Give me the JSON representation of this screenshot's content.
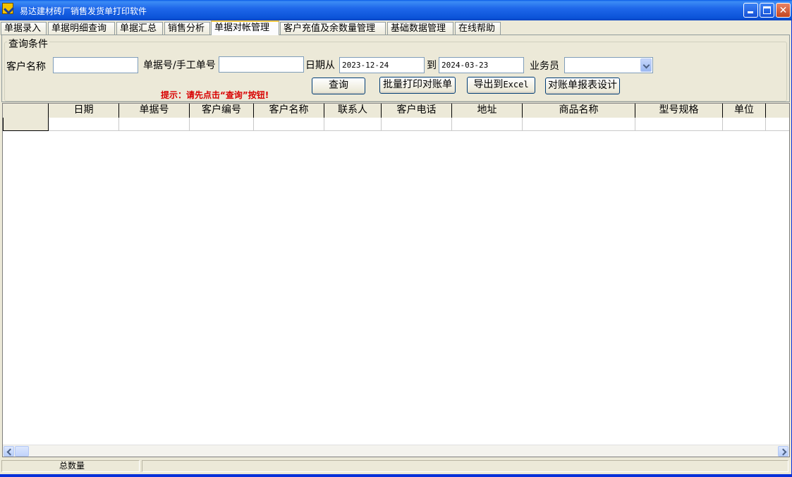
{
  "window": {
    "title": "易达建材砖厂销售发货单打印软件",
    "buttons": {
      "minimize": "minimize",
      "maximize": "maximize",
      "close": "✕"
    }
  },
  "tabs": [
    {
      "label": "单据录入",
      "active": false
    },
    {
      "label": "单据明细查询",
      "active": false
    },
    {
      "label": "单据汇总",
      "active": false
    },
    {
      "label": "销售分析",
      "active": false
    },
    {
      "label": "单据对帐管理",
      "active": true
    },
    {
      "label": "客户充值及余数量管理",
      "active": false
    },
    {
      "label": "基础数据管理",
      "active": false
    },
    {
      "label": "在线帮助",
      "active": false
    }
  ],
  "query": {
    "group_title": "查询条件",
    "customer_name_label": "客户名称",
    "customer_name_value": "",
    "bill_no_label": "单据号/手工单号",
    "bill_no_value": "",
    "date_from_label": "日期从",
    "date_from_value": "2023-12-24",
    "date_to_label": "到",
    "date_to_value": "2024-03-23",
    "salesman_label": "业务员",
    "salesman_value": "",
    "hint": "提示：请先点击“查询”按钮!",
    "buttons": {
      "query": "查询",
      "batch_print": "批量打印对账单",
      "export_prefix": "导出到",
      "export_suffix": "Excel",
      "report_design": "对账单报表设计"
    }
  },
  "grid": {
    "columns": [
      "日期",
      "单据号",
      "客户编号",
      "客户名称",
      "联系人",
      "客户电话",
      "地址",
      "商品名称",
      "型号规格",
      "单位"
    ],
    "rows": []
  },
  "statusbar": {
    "total_quantity_label": "总数量",
    "total_quantity_value": ""
  },
  "colors": {
    "titlebar": "#0b53d8",
    "window_bg": "#ece9d8",
    "hint": "#d80000",
    "active_tab_accent": "#ffc83c"
  }
}
